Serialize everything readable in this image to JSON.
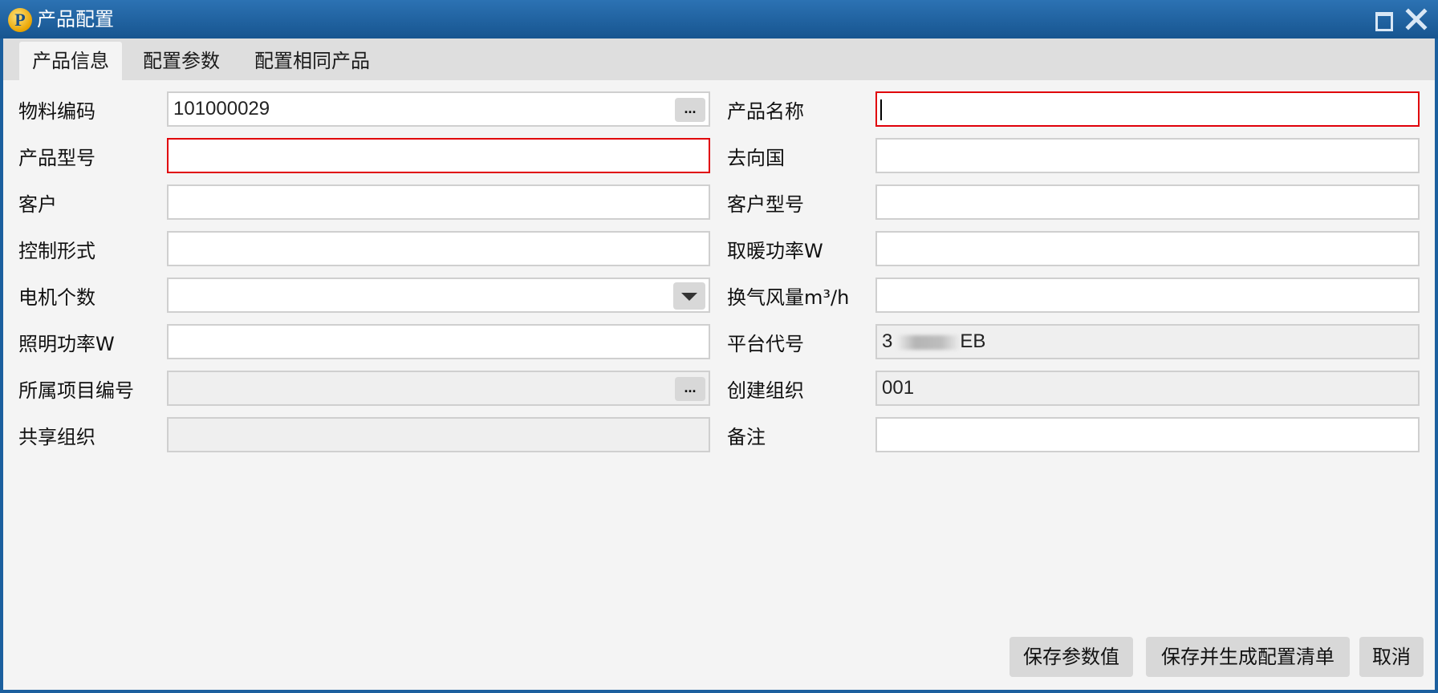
{
  "window": {
    "title": "产品配置",
    "logo_letter": "P"
  },
  "tabs": [
    {
      "label": "产品信息",
      "active": true
    },
    {
      "label": "配置参数",
      "active": false
    },
    {
      "label": "配置相同产品",
      "active": false
    }
  ],
  "form": {
    "material_code": {
      "label": "物料编码",
      "value": "101000029"
    },
    "product_name": {
      "label": "产品名称",
      "value": ""
    },
    "product_model": {
      "label": "产品型号",
      "value": ""
    },
    "destination_country": {
      "label": "去向国",
      "value": ""
    },
    "customer": {
      "label": "客户",
      "value": ""
    },
    "customer_model": {
      "label": "客户型号",
      "value": ""
    },
    "control_form": {
      "label": "控制形式",
      "value": ""
    },
    "heating_power": {
      "label": "取暖功率W",
      "value": ""
    },
    "motor_count": {
      "label": "电机个数",
      "value": ""
    },
    "ventilation_volume": {
      "label": "换气风量m³/h",
      "value": ""
    },
    "lighting_power": {
      "label": "照明功率W",
      "value": ""
    },
    "platform_code": {
      "label": "平台代号",
      "value_prefix": "3",
      "value_suffix": "EB"
    },
    "project_number": {
      "label": "所属项目编号",
      "value": ""
    },
    "created_org": {
      "label": "创建组织",
      "value": "001"
    },
    "shared_org": {
      "label": "共享组织",
      "value": ""
    },
    "remarks": {
      "label": "备注",
      "value": ""
    }
  },
  "ellipsis_label": "...",
  "buttons": {
    "save_params": "保存参数值",
    "save_generate": "保存并生成配置清单",
    "cancel": "取消"
  },
  "icons": {
    "maximize": "maximize-icon",
    "close": "close-icon",
    "dropdown": "chevron-down-icon"
  },
  "colors": {
    "title_bar": "#1b5f9e",
    "required_border": "#e0000a"
  }
}
